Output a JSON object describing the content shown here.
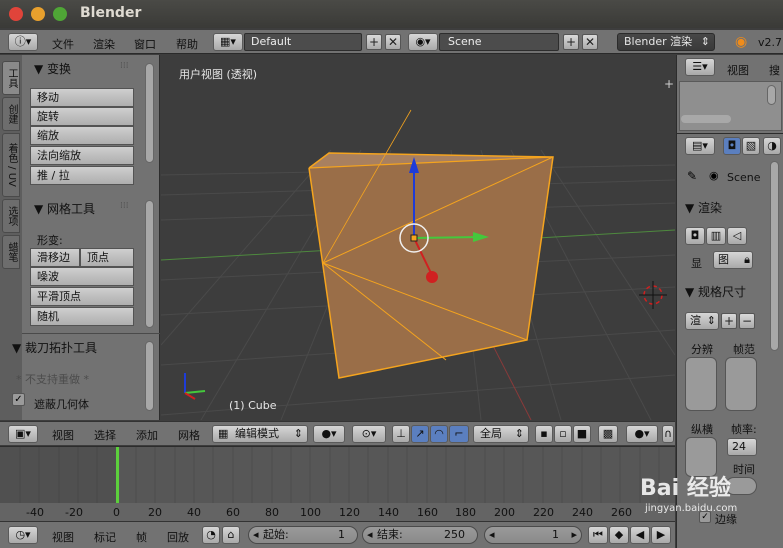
{
  "window": {
    "title": "Blender"
  },
  "info_header": {
    "menus": [
      "文件",
      "渲染",
      "窗口",
      "帮助"
    ],
    "layout": "Default",
    "scene": "Scene",
    "engine": "Blender 渲染",
    "version": "v2.7"
  },
  "tool_shelf": {
    "tabs": [
      "工具",
      "创建",
      "着色 / UV",
      "选项",
      "蜡笔"
    ],
    "transform_panel": {
      "title": "▼ 变换",
      "buttons": [
        "移动",
        "旋转",
        "缩放",
        "法向缩放",
        "推 / 拉"
      ]
    },
    "mesh_tools_panel": {
      "title": "▼ 网格工具",
      "deform_label": "形变:",
      "slide_edge": "滑移边",
      "vertex": "顶点",
      "buttons": [
        "噪波",
        "平滑顶点",
        "随机"
      ]
    },
    "knife_panel": {
      "title": "▼ 裁刀拓扑工具",
      "note": "* 不支持重做 *",
      "occlude_label": "遮蔽几何体"
    }
  },
  "viewport": {
    "title": "用户视图 (透视)",
    "object_label": "(1) Cube"
  },
  "viewport_header": {
    "menus": [
      "视图",
      "选择",
      "添加",
      "网格"
    ],
    "mode": "编辑模式",
    "pivot": "全局"
  },
  "properties": {
    "view_menu": "视图",
    "search_menu": "搜",
    "scene": "Scene",
    "render_panel": "▼ 渲染",
    "display_label": "显",
    "display_value": "图",
    "dimensions_panel": "▼ 规格尺寸",
    "preset_value": "渲",
    "resolution_label": "分辨",
    "frame_range_label": "帧范",
    "aspect_label": "纵横",
    "frame_rate_label": "帧率:",
    "frame_rate_value": "24",
    "time_label": "时间",
    "border_label": "边缘"
  },
  "timeline": {
    "ruler": [
      "-40",
      "-20",
      "0",
      "20",
      "40",
      "60",
      "80",
      "100",
      "120",
      "140",
      "160",
      "180",
      "200",
      "220",
      "240",
      "260"
    ],
    "current_frame": 1
  },
  "timeline_header": {
    "menus": [
      "视图",
      "标记",
      "帧",
      "回放"
    ],
    "start_label": "起始:",
    "start_value": "1",
    "end_label": "结束:",
    "end_value": "250",
    "current_value": "1"
  },
  "colors": {
    "accent": "#d0923f",
    "wire": "#f5a41e",
    "face": "#9a6d45",
    "cursor_red": "#d02020",
    "axis_green": "#44c83c",
    "axis_blue": "#1e3cd8"
  },
  "watermark": {
    "text": "Bai 经验",
    "url": "jingyan.baidu.com"
  }
}
